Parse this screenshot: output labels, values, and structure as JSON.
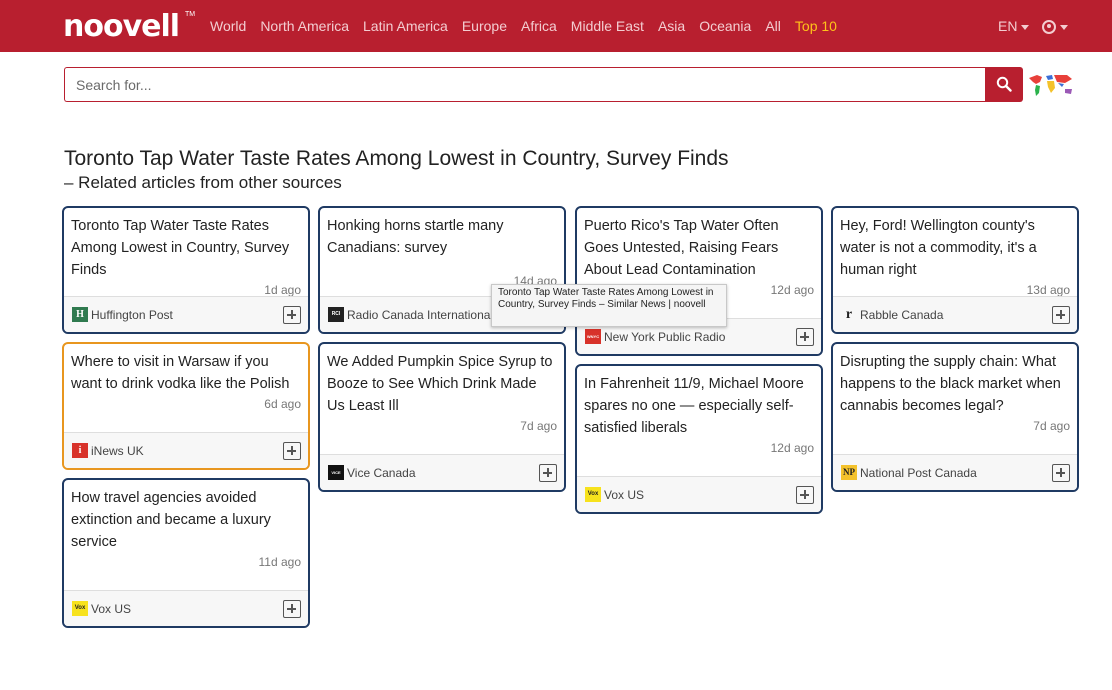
{
  "brand": {
    "logo": "noovell",
    "tm": "TM"
  },
  "nav": {
    "items": [
      "World",
      "North America",
      "Latin America",
      "Europe",
      "Africa",
      "Middle East",
      "Asia",
      "Oceania",
      "All"
    ],
    "top10": "Top 10",
    "language": "EN"
  },
  "search": {
    "placeholder": "Search for...",
    "value": ""
  },
  "page": {
    "title": "Toronto Tap Water Taste Rates Among Lowest in Country, Survey Finds",
    "subtitle": "– Related articles from other sources"
  },
  "cards": [
    {
      "title": "Toronto Tap Water Taste Rates Among Lowest in Country, Survey Finds",
      "age": "1d ago",
      "source": "Huffington Post",
      "icon": "huffington-post-logo",
      "icon_glyph": "H"
    },
    {
      "title": "Where to visit in Warsaw if you want to drink vodka like the Polish",
      "age": "6d ago",
      "source": "iNews UK",
      "icon": "inews-logo",
      "icon_glyph": "i"
    },
    {
      "title": "How travel agencies avoided extinction and became a luxury service",
      "age": "11d ago",
      "source": "Vox US",
      "icon": "vox-logo",
      "icon_glyph": "Vox"
    },
    {
      "title": "Honking horns startle many Canadians: survey",
      "age": "14d ago",
      "source": "Radio Canada International",
      "icon": "rci-logo",
      "icon_glyph": "RCI"
    },
    {
      "title": "We Added Pumpkin Spice Syrup to Booze to See Which Drink Made Us Least Ill",
      "age": "7d ago",
      "source": "Vice Canada",
      "icon": "vice-logo",
      "icon_glyph": "VICE"
    },
    {
      "title": "Puerto Rico's Tap Water Often Goes Untested, Raising Fears About Lead Contamination",
      "age": "12d ago",
      "source": "New York Public Radio",
      "icon": "wnyc-logo",
      "icon_glyph": "WNYC"
    },
    {
      "title": "In Fahrenheit 11/9, Michael Moore spares no one — especially self-satisfied liberals",
      "age": "12d ago",
      "source": "Vox US",
      "icon": "vox-logo",
      "icon_glyph": "Vox"
    },
    {
      "title": "Hey, Ford! Wellington county's water is not a commodity, it's a human right",
      "age": "13d ago",
      "source": "Rabble Canada",
      "icon": "rabble-logo",
      "icon_glyph": "r"
    },
    {
      "title": "Disrupting the supply chain: What happens to the black market when cannabis becomes legal?",
      "age": "7d ago",
      "source": "National Post Canada",
      "icon": "national-post-logo",
      "icon_glyph": "NP"
    }
  ],
  "tooltip": {
    "text": "Toronto Tap Water Taste Rates Among Lowest in Country, Survey Finds – Similar News | noovell"
  },
  "colors": {
    "brand_red": "#b81f2f",
    "card_border": "#1f3a63",
    "highlight_border": "#e8961f",
    "top10": "#ffc21a"
  }
}
